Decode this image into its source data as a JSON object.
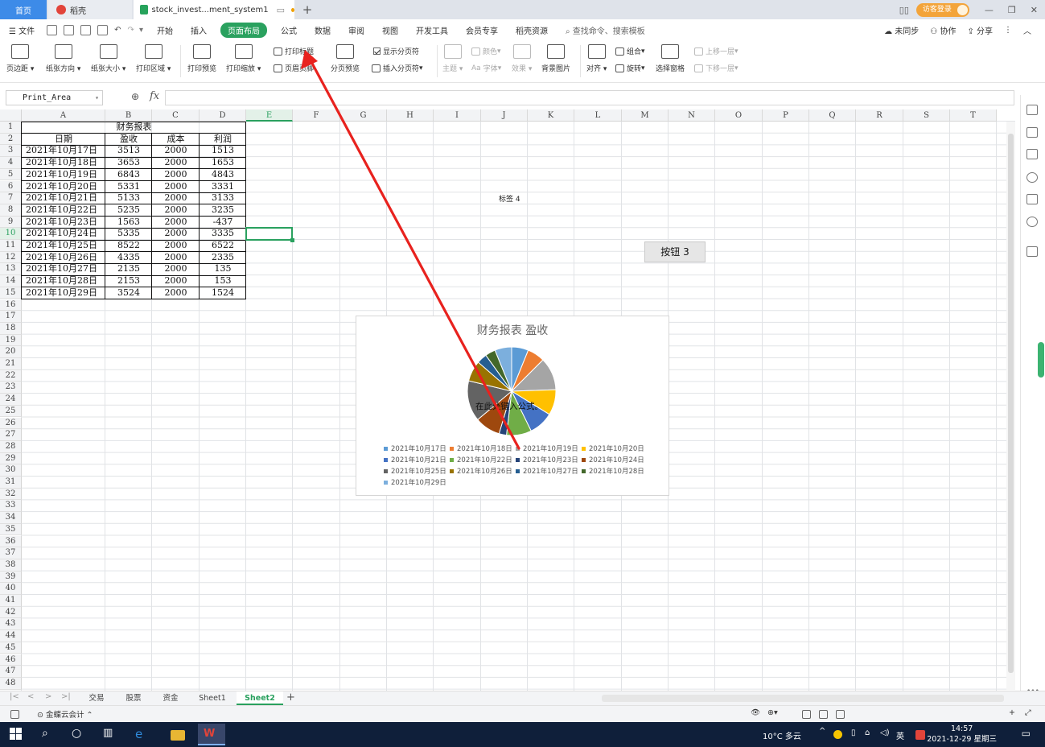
{
  "tabs": {
    "home": "首页",
    "docer": "稻壳",
    "doc": "stock_invest...ment_system1"
  },
  "titlebar_right": {
    "login": "访客登录"
  },
  "menu": {
    "file": "文件",
    "items": [
      "开始",
      "插入",
      "页面布局",
      "公式",
      "数据",
      "审阅",
      "视图",
      "开发工具",
      "会员专享",
      "稻壳资源"
    ],
    "active_index": 2,
    "search": "查找命令、搜索模板",
    "unsync": "未同步",
    "collab": "协作",
    "share": "分享"
  },
  "ribbon": {
    "margins": "页边距",
    "orientation": "纸张方向",
    "size": "纸张大小",
    "print_area": "打印区域",
    "print_preview": "打印预览",
    "print_scale": "打印缩放",
    "print_titles": "打印标题",
    "header_footer": "页眉页脚",
    "page_break_preview": "分页预览",
    "show_page_breaks": "显示分页符",
    "insert_page_break": "插入分页符",
    "theme": "主题",
    "colors": "颜色",
    "fonts": "字体",
    "effects": "效果",
    "background": "背景图片",
    "align": "对齐",
    "group": "组合",
    "rotate": "旋转",
    "selection_pane": "选择窗格",
    "bring_forward": "上移一层",
    "send_backward": "下移一层"
  },
  "formula_bar": {
    "name_box": "Print_Area",
    "fx": "fx",
    "value": ""
  },
  "sheet": {
    "columns": [
      "A",
      "B",
      "C",
      "D",
      "E",
      "F",
      "G",
      "H",
      "I",
      "J",
      "K",
      "L",
      "M",
      "N",
      "O",
      "P",
      "Q",
      "R",
      "S",
      "T"
    ],
    "selected_column": "E",
    "selected_row": 10,
    "row_count": 48,
    "table_title": "财务报表",
    "headers": [
      "日期",
      "盈收",
      "成本",
      "利润"
    ],
    "rows": [
      [
        "2021年10月17日",
        "3513",
        "2000",
        "1513"
      ],
      [
        "2021年10月18日",
        "3653",
        "2000",
        "1653"
      ],
      [
        "2021年10月19日",
        "6843",
        "2000",
        "4843"
      ],
      [
        "2021年10月20日",
        "5331",
        "2000",
        "3331"
      ],
      [
        "2021年10月21日",
        "5133",
        "2000",
        "3133"
      ],
      [
        "2021年10月22日",
        "5235",
        "2000",
        "3235"
      ],
      [
        "2021年10月23日",
        "1563",
        "2000",
        "-437"
      ],
      [
        "2021年10月24日",
        "5335",
        "2000",
        "3335"
      ],
      [
        "2021年10月25日",
        "8522",
        "2000",
        "6522"
      ],
      [
        "2021年10月26日",
        "4335",
        "2000",
        "2335"
      ],
      [
        "2021年10月27日",
        "2135",
        "2000",
        "135"
      ],
      [
        "2021年10月28日",
        "2153",
        "2000",
        "153"
      ],
      [
        "2021年10月29日",
        "3524",
        "2000",
        "1524"
      ]
    ]
  },
  "objects": {
    "label": "标签 4",
    "button": "按钮 3"
  },
  "chart_data": {
    "type": "pie",
    "title": "财务报表 盈收",
    "overlay_text": "在此处键入公式。",
    "categories": [
      "2021年10月17日",
      "2021年10月18日",
      "2021年10月19日",
      "2021年10月20日",
      "2021年10月21日",
      "2021年10月22日",
      "2021年10月23日",
      "2021年10月24日",
      "2021年10月25日",
      "2021年10月26日",
      "2021年10月27日",
      "2021年10月28日",
      "2021年10月29日"
    ],
    "values": [
      3513,
      3653,
      6843,
      5331,
      5133,
      5235,
      1563,
      5335,
      8522,
      4335,
      2135,
      2153,
      3524
    ],
    "colors": [
      "#5b9bd5",
      "#ed7d31",
      "#a5a5a5",
      "#ffc000",
      "#4472c4",
      "#70ad47",
      "#264478",
      "#9e480e",
      "#636363",
      "#997300",
      "#255e91",
      "#43682b",
      "#7cafdd"
    ],
    "legend_position": "bottom"
  },
  "sheet_tabs": {
    "tabs": [
      "交易",
      "股票",
      "资金",
      "Sheet1",
      "Sheet2"
    ],
    "active": "Sheet2"
  },
  "statusbar": {
    "addin": "金蝶云会计"
  },
  "taskbar": {
    "weather": "10°C 多云",
    "ime": "英",
    "time": "14:57",
    "date": "2021-12-29 星期三"
  },
  "annotation": {
    "color": "#e8221e"
  }
}
